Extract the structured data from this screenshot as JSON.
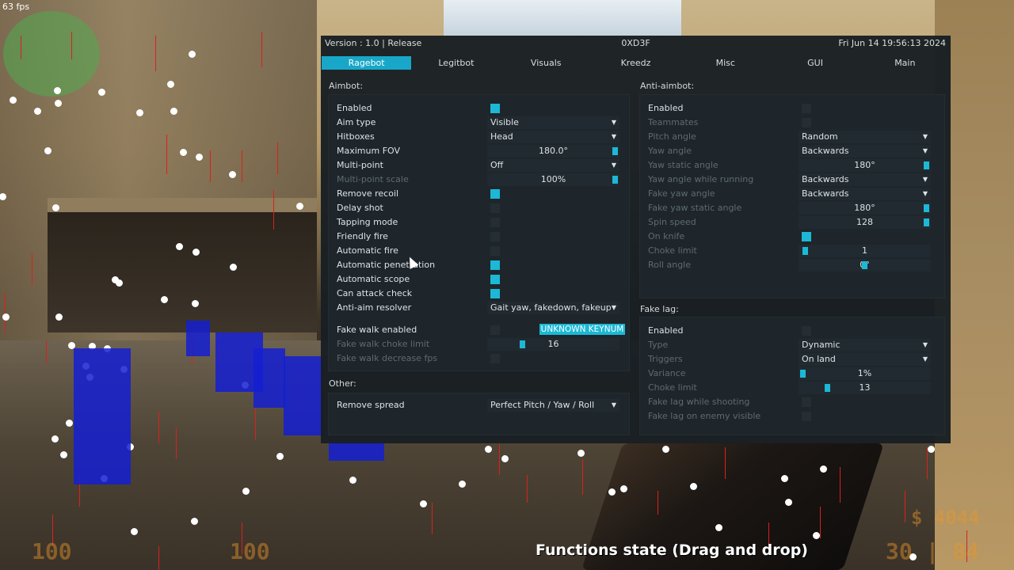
{
  "hud": {
    "fps": "63 fps",
    "functions_state": "Functions state (Drag and drop)",
    "health": "100",
    "armor": "100",
    "money": "$ 4044",
    "ammo": "30 | 84"
  },
  "menu": {
    "version": "Version : 1.0 | Release",
    "title": "0XD3F",
    "datetime": "Fri Jun 14 19:56:13 2024",
    "accent": "#18a7c8",
    "tabs": [
      "Ragebot",
      "Legitbot",
      "Visuals",
      "Kreedz",
      "Misc",
      "GUI",
      "Main"
    ],
    "active_tab": "Ragebot"
  },
  "aimbot": {
    "title": "Aimbot:",
    "enabled": "Enabled",
    "aim_type": "Aim type",
    "aim_type_value": "Visible",
    "hitboxes": "Hitboxes",
    "hitboxes_value": "Head",
    "max_fov": "Maximum FOV",
    "max_fov_value": "180.0°",
    "multipoint": "Multi-point",
    "multipoint_value": "Off",
    "multipoint_scale": "Multi-point scale",
    "multipoint_scale_value": "100%",
    "remove_recoil": "Remove recoil",
    "delay_shot": "Delay shot",
    "tapping_mode": "Tapping mode",
    "friendly_fire": "Friendly fire",
    "automatic_fire": "Automatic fire",
    "automatic_penetration": "Automatic penetration",
    "automatic_scope": "Automatic scope",
    "can_attack_check": "Can attack check",
    "anti_aim_resolver": "Anti-aim resolver",
    "anti_aim_resolver_value": "Gait yaw, fakedown, fakeup",
    "fake_walk_enabled": "Fake walk enabled",
    "fake_walk_key": "UNKNOWN KEYNUM",
    "fake_walk_choke": "Fake walk choke limit",
    "fake_walk_choke_value": "16",
    "fake_walk_decrease": "Fake walk decrease fps"
  },
  "other": {
    "title": "Other:",
    "remove_spread": "Remove spread",
    "remove_spread_value": "Perfect Pitch / Yaw / Roll"
  },
  "antiaim": {
    "title": "Anti-aimbot:",
    "enabled": "Enabled",
    "teammates": "Teammates",
    "pitch_angle": "Pitch angle",
    "pitch_angle_value": "Random",
    "yaw_angle": "Yaw angle",
    "yaw_angle_value": "Backwards",
    "yaw_static": "Yaw static angle",
    "yaw_static_value": "180°",
    "yaw_running": "Yaw angle while running",
    "yaw_running_value": "Backwards",
    "fake_yaw": "Fake yaw angle",
    "fake_yaw_value": "Backwards",
    "fake_yaw_static": "Fake yaw static angle",
    "fake_yaw_static_value": "180°",
    "spin_speed": "Spin speed",
    "spin_speed_value": "128",
    "on_knife": "On knife",
    "choke_limit": "Choke limit",
    "choke_limit_value": "1",
    "roll_angle": "Roll angle",
    "roll_angle_value": "0°"
  },
  "fakelag": {
    "title": "Fake lag:",
    "enabled": "Enabled",
    "type": "Type",
    "type_value": "Dynamic",
    "triggers": "Triggers",
    "triggers_value": "On land",
    "variance": "Variance",
    "variance_value": "1%",
    "choke_limit": "Choke limit",
    "choke_limit_value": "13",
    "while_shooting": "Fake lag while shooting",
    "enemy_visible": "Fake lag on enemy visible"
  }
}
